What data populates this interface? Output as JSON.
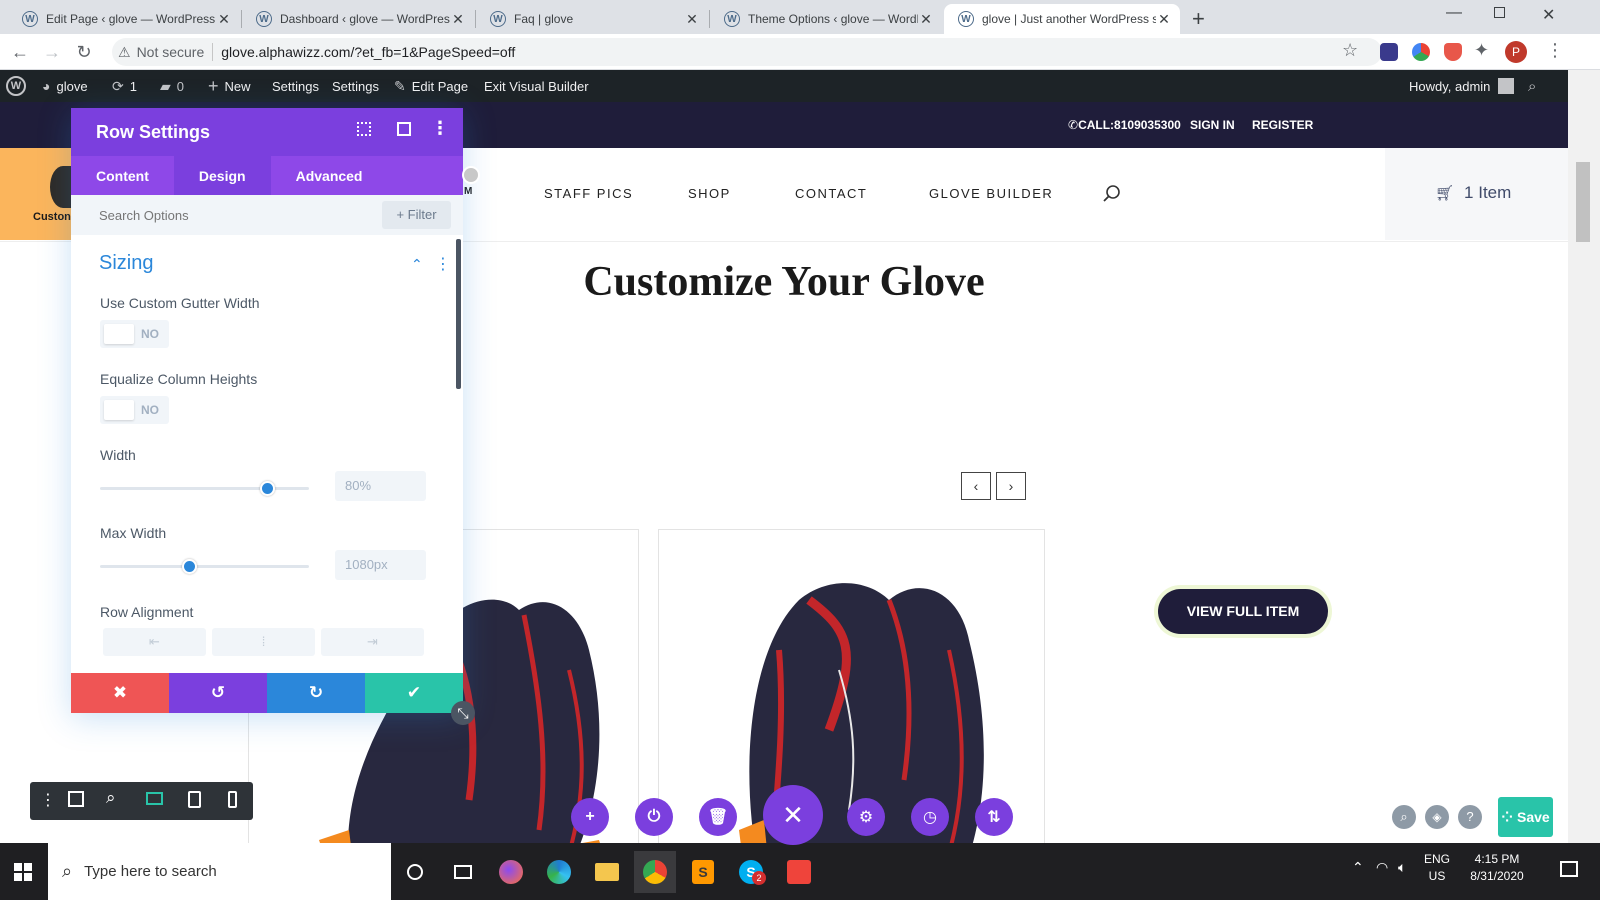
{
  "browser": {
    "tabs": [
      {
        "title": "Edit Page ‹ glove — WordPress"
      },
      {
        "title": "Dashboard ‹ glove — WordPress"
      },
      {
        "title": "Faq | glove"
      },
      {
        "title": "Theme Options ‹ glove — WordP"
      },
      {
        "title": "glove | Just another WordPress si",
        "active": true
      }
    ],
    "security": "Not secure",
    "url": "glove.alphawizz.com/?et_fb=1&PageSpeed=off",
    "profile_initial": "P"
  },
  "wp_admin_bar": {
    "site": "glove",
    "updates": "1",
    "comments": "0",
    "new": "New",
    "settings1": "Settings",
    "settings2": "Settings",
    "edit_page": "Edit Page",
    "exit_vb": "Exit Visual Builder",
    "howdy": "Howdy, admin"
  },
  "site": {
    "call": "CALL:8109035300",
    "sign_in": "SIGN IN",
    "register": "REGISTER",
    "nav": {
      "partial": "M",
      "staff_pics": "STAFF PICS",
      "shop": "SHOP",
      "contact": "CONTACT",
      "glove_builder": "GLOVE BUILDER"
    },
    "cart": "1 Item",
    "custom_partial": "Custon",
    "heading": "Customize Your Glove",
    "view_full_item": "VIEW FULL ITEM"
  },
  "panel": {
    "title": "Row Settings",
    "tabs": [
      "Content",
      "Design",
      "Advanced"
    ],
    "active_tab": "Design",
    "search_placeholder": "Search Options",
    "filter": "+ Filter",
    "section": "Sizing",
    "fields": {
      "gutter": {
        "label": "Use Custom Gutter Width",
        "value": "NO"
      },
      "equalize": {
        "label": "Equalize Column Heights",
        "value": "NO"
      },
      "width": {
        "label": "Width",
        "value": "80%",
        "slider_fraction": 0.8
      },
      "max_width": {
        "label": "Max Width",
        "value": "1080px",
        "slider_fraction": 0.43
      },
      "row_alignment": {
        "label": "Row Alignment"
      }
    }
  },
  "builder": {
    "save": "Save"
  },
  "taskbar": {
    "search_placeholder": "Type here to search",
    "lang": "ENG",
    "region": "US",
    "time": "4:15 PM",
    "date": "8/31/2020",
    "skype_badge": "2"
  },
  "colors": {
    "purple": "#7b3fde",
    "purple_tabs": "#8e48e8",
    "blue": "#2b87da",
    "red": "#ef5555",
    "green": "#29c4a9",
    "navy": "#1f1d3a",
    "orange": "#fbb55c"
  }
}
